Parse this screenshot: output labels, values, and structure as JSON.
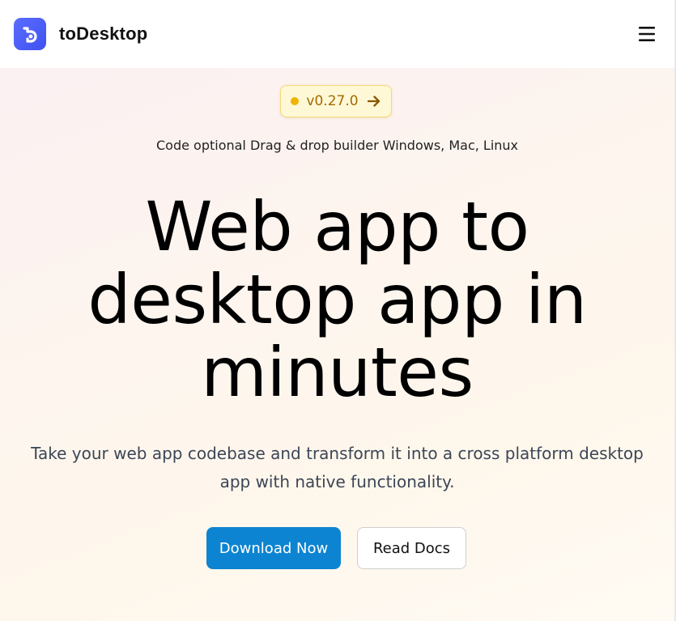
{
  "header": {
    "brand": "toDesktop",
    "logo_icon": "todesktop-logo-icon",
    "menu_icon": "hamburger-menu-icon"
  },
  "hero": {
    "version_badge": {
      "label": "v0.27.0",
      "dot_color": "#f0b400",
      "arrow_icon": "arrow-right-icon"
    },
    "tagline": "Code optional Drag & drop builder Windows, Mac, Linux",
    "headline": "Web app to desktop app in minutes",
    "subtext": "Take your web app codebase and transform it into a cross platform desktop app with native functionality.",
    "primary_button": "Download Now",
    "secondary_button": "Read Docs"
  },
  "colors": {
    "logo_blue": "#4a5cf5",
    "primary_button": "#0d84d1",
    "badge_background": "#fef8d6",
    "badge_text": "#a46a00"
  }
}
